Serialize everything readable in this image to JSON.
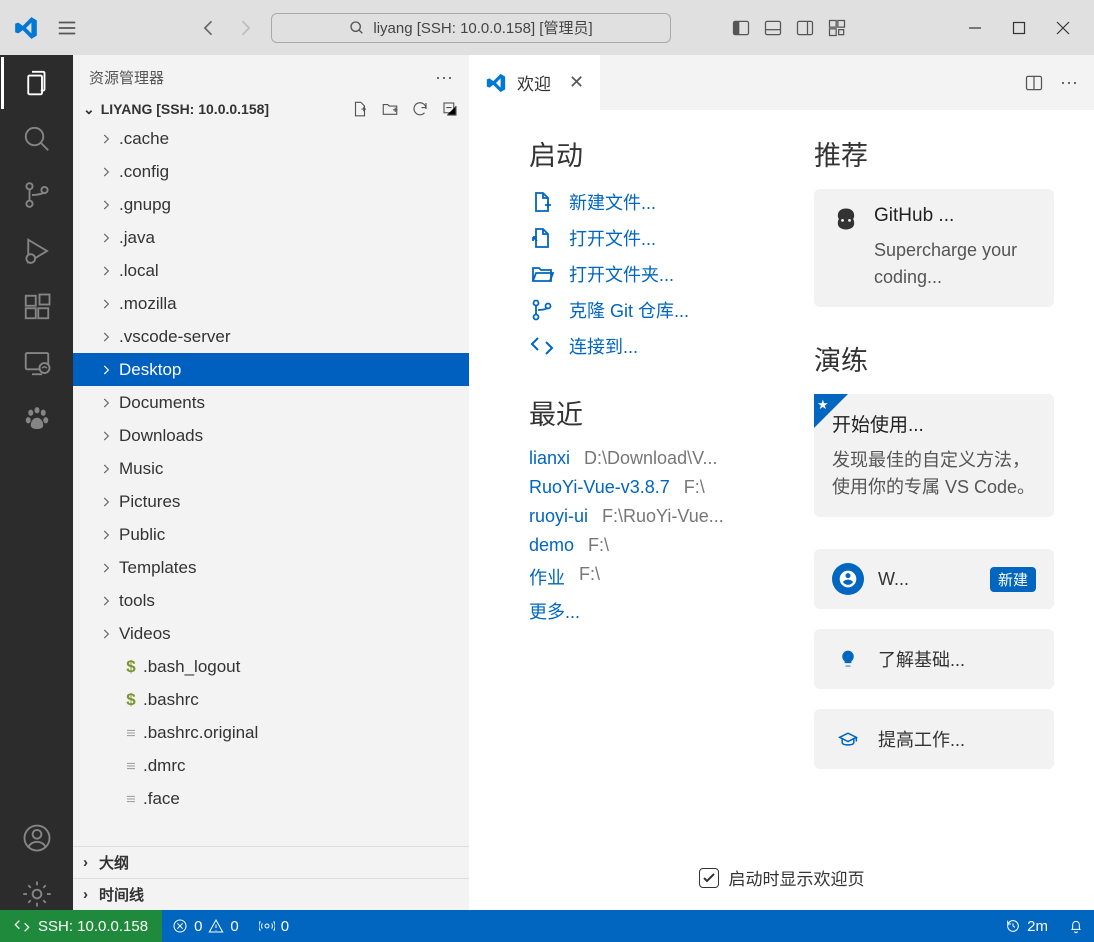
{
  "titlebar": {
    "search_text": "liyang [SSH: 10.0.0.158] [管理员]"
  },
  "sidebar": {
    "title": "资源管理器",
    "root": "LIYANG [SSH: 10.0.0.158]",
    "items": [
      {
        "name": ".cache",
        "kind": "folder"
      },
      {
        "name": ".config",
        "kind": "folder"
      },
      {
        "name": ".gnupg",
        "kind": "folder"
      },
      {
        "name": ".java",
        "kind": "folder"
      },
      {
        "name": ".local",
        "kind": "folder"
      },
      {
        "name": ".mozilla",
        "kind": "folder"
      },
      {
        "name": ".vscode-server",
        "kind": "folder"
      },
      {
        "name": "Desktop",
        "kind": "folder",
        "selected": true
      },
      {
        "name": "Documents",
        "kind": "folder"
      },
      {
        "name": "Downloads",
        "kind": "folder"
      },
      {
        "name": "Music",
        "kind": "folder"
      },
      {
        "name": "Pictures",
        "kind": "folder"
      },
      {
        "name": "Public",
        "kind": "folder"
      },
      {
        "name": "Templates",
        "kind": "folder"
      },
      {
        "name": "tools",
        "kind": "folder"
      },
      {
        "name": "Videos",
        "kind": "folder"
      },
      {
        "name": ".bash_logout",
        "kind": "dollar"
      },
      {
        "name": ".bashrc",
        "kind": "dollar"
      },
      {
        "name": ".bashrc.original",
        "kind": "file"
      },
      {
        "name": ".dmrc",
        "kind": "file"
      },
      {
        "name": ".face",
        "kind": "file"
      }
    ],
    "outline": "大纲",
    "timeline": "时间线"
  },
  "tabs": {
    "welcome": "欢迎"
  },
  "welcome": {
    "start_h": "启动",
    "start": [
      {
        "label": "新建文件...",
        "icon": "new-file"
      },
      {
        "label": "打开文件...",
        "icon": "open-file"
      },
      {
        "label": "打开文件夹...",
        "icon": "open-folder"
      },
      {
        "label": "克隆 Git 仓库...",
        "icon": "git"
      },
      {
        "label": "连接到...",
        "icon": "connect"
      }
    ],
    "recent_h": "最近",
    "recent": [
      {
        "name": "lianxi",
        "path": "D:\\Download\\V..."
      },
      {
        "name": "RuoYi-Vue-v3.8.7",
        "path": "F:\\"
      },
      {
        "name": "ruoyi-ui",
        "path": "F:\\RuoYi-Vue..."
      },
      {
        "name": "demo",
        "path": "F:\\"
      },
      {
        "name": "作业",
        "path": "F:\\"
      }
    ],
    "more": "更多...",
    "recommend_h": "推荐",
    "github": {
      "title": "GitHub ...",
      "desc": "Supercharge your coding..."
    },
    "walk_h": "演练",
    "featured": {
      "title": "开始使用...",
      "desc": "发现最佳的自定义方法，使用你的专属 VS Code。"
    },
    "walk": [
      {
        "title": "W...",
        "badge": "新建",
        "icon_bg": "#0066bf"
      },
      {
        "title": "了解基础...",
        "icon_bg": "transparent"
      },
      {
        "title": "提高工作...",
        "icon_bg": "transparent"
      }
    ],
    "show_welcome": "启动时显示欢迎页"
  },
  "statusbar": {
    "remote": "SSH: 10.0.0.158",
    "errors": "0",
    "warnings": "0",
    "ports": "0",
    "time": "2m"
  }
}
